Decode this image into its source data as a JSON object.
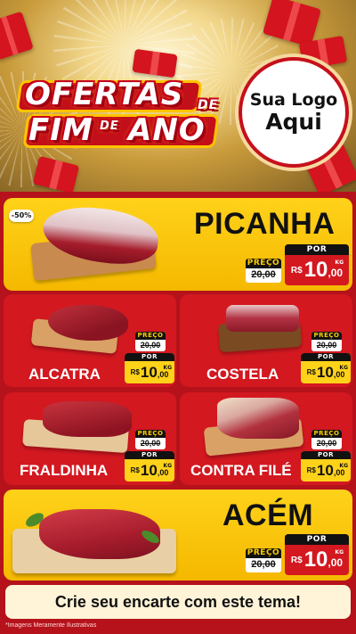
{
  "header": {
    "title_line1": "OFERTAS",
    "title_de_1": "DE",
    "title_line2_a": "FIM",
    "title_de_2": "DE",
    "title_line2_b": "ANO",
    "logo_line1": "Sua Logo",
    "logo_line2": "Aqui"
  },
  "colors": {
    "brand_red": "#d31820",
    "brand_yellow": "#ffd21a",
    "dark": "#111111",
    "gold": "#ffc400"
  },
  "featured_top": {
    "badge": "-50%",
    "name": "PICANHA",
    "old_label": "PREÇO",
    "old_price": "20,00",
    "new_label": "POR",
    "currency": "R$",
    "price_int": "10",
    "price_cents": ",00",
    "unit": "KG"
  },
  "products": [
    {
      "name": "ALCATRA",
      "old_label": "PREÇO",
      "old_price": "20,00",
      "new_label": "POR",
      "currency": "R$",
      "price_int": "10",
      "price_cents": ",00",
      "unit": "KG"
    },
    {
      "name": "COSTELA",
      "old_label": "PREÇO",
      "old_price": "20,00",
      "new_label": "POR",
      "currency": "R$",
      "price_int": "10",
      "price_cents": ",00",
      "unit": "KG"
    },
    {
      "name": "FRALDINHA",
      "old_label": "PREÇO",
      "old_price": "20,00",
      "new_label": "POR",
      "currency": "R$",
      "price_int": "10",
      "price_cents": ",00",
      "unit": "KG"
    },
    {
      "name": "CONTRA FILÉ",
      "old_label": "PREÇO",
      "old_price": "20,00",
      "new_label": "POR",
      "currency": "R$",
      "price_int": "10",
      "price_cents": ",00",
      "unit": "KG"
    }
  ],
  "featured_bottom": {
    "name": "ACÉM",
    "old_label": "PREÇO",
    "old_price": "20,00",
    "new_label": "POR",
    "currency": "R$",
    "price_int": "10",
    "price_cents": ",00",
    "unit": "KG"
  },
  "cta": "Crie seu encarte com este tema!",
  "disclaimer": "*Imagens Meramente Ilustrativas"
}
